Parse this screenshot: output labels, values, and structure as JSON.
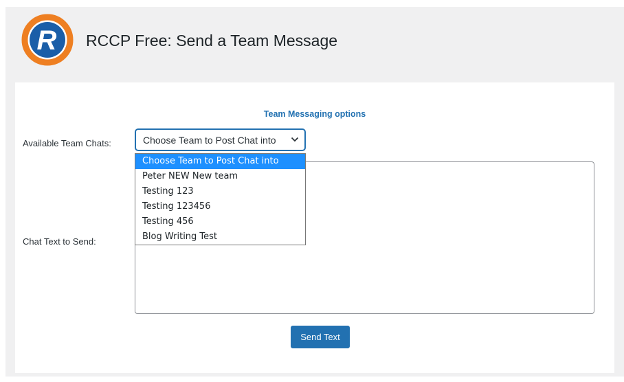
{
  "header": {
    "title": "RCCP Free: Send a Team Message",
    "logo_letter": "R",
    "logo_icon": "rccp-logo-icon"
  },
  "form": {
    "heading": "Team Messaging options",
    "teams_label": "Available Team Chats:",
    "select_value": "Choose Team to Post Chat into",
    "chat_label": "Chat Text to Send:",
    "textarea_value": "",
    "send_label": "Send Text"
  },
  "dropdown": {
    "options": [
      "Choose Team to Post Chat into",
      "Peter NEW New team",
      "Testing 123",
      "Testing 123456",
      "Testing 456",
      "Blog Writing Test"
    ],
    "selected_index": 0
  },
  "colors": {
    "accent": "#2271b1",
    "highlight": "#1e90ff",
    "logo_ring": "#ee7f22",
    "logo_fill": "#1a5ea8",
    "background": "#f0f0f1"
  }
}
